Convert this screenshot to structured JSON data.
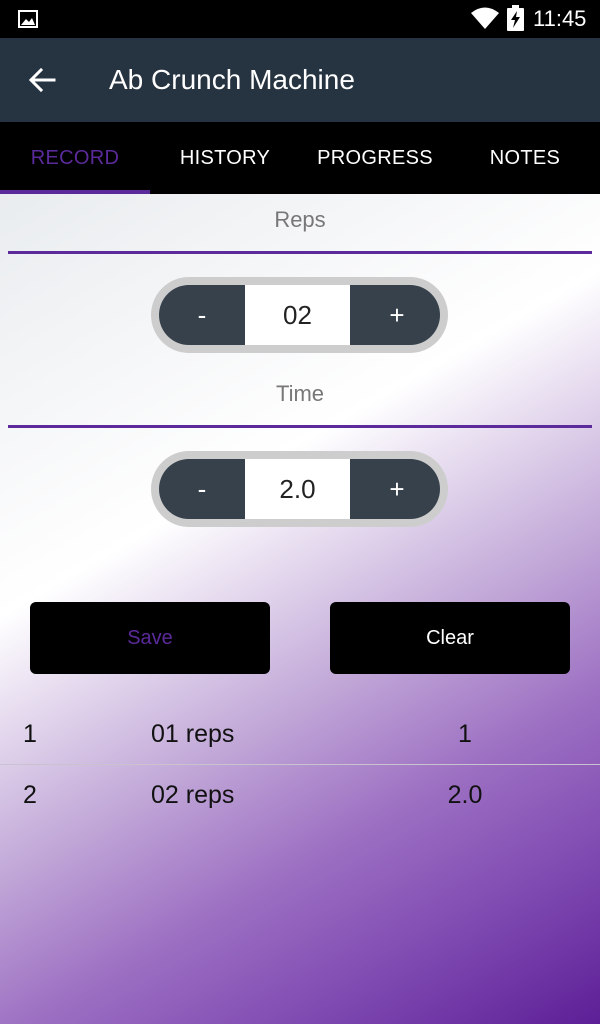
{
  "status_bar": {
    "time": "11:45",
    "icons": [
      "image-notification-icon",
      "wifi-icon",
      "battery-charging-icon"
    ]
  },
  "app_bar": {
    "title": "Ab Crunch Machine",
    "back_icon": "arrow-left-icon"
  },
  "tabs": [
    {
      "label": "RECORD",
      "active": true
    },
    {
      "label": "HISTORY",
      "active": false
    },
    {
      "label": "PROGRESS",
      "active": false
    },
    {
      "label": "NOTES",
      "active": false
    }
  ],
  "record": {
    "reps": {
      "label": "Reps",
      "value": "02",
      "minus": "-",
      "plus": "+"
    },
    "time": {
      "label": "Time",
      "value": "2.0",
      "minus": "-",
      "plus": "+"
    },
    "save_label": "Save",
    "clear_label": "Clear"
  },
  "log": [
    {
      "num": "1",
      "reps": "01 reps",
      "time": "1"
    },
    {
      "num": "2",
      "reps": "02 reps",
      "time": "2.0"
    }
  ],
  "colors": {
    "accent": "#5b2a9a",
    "app_bar": "#263340",
    "stepper": "#36414c"
  }
}
